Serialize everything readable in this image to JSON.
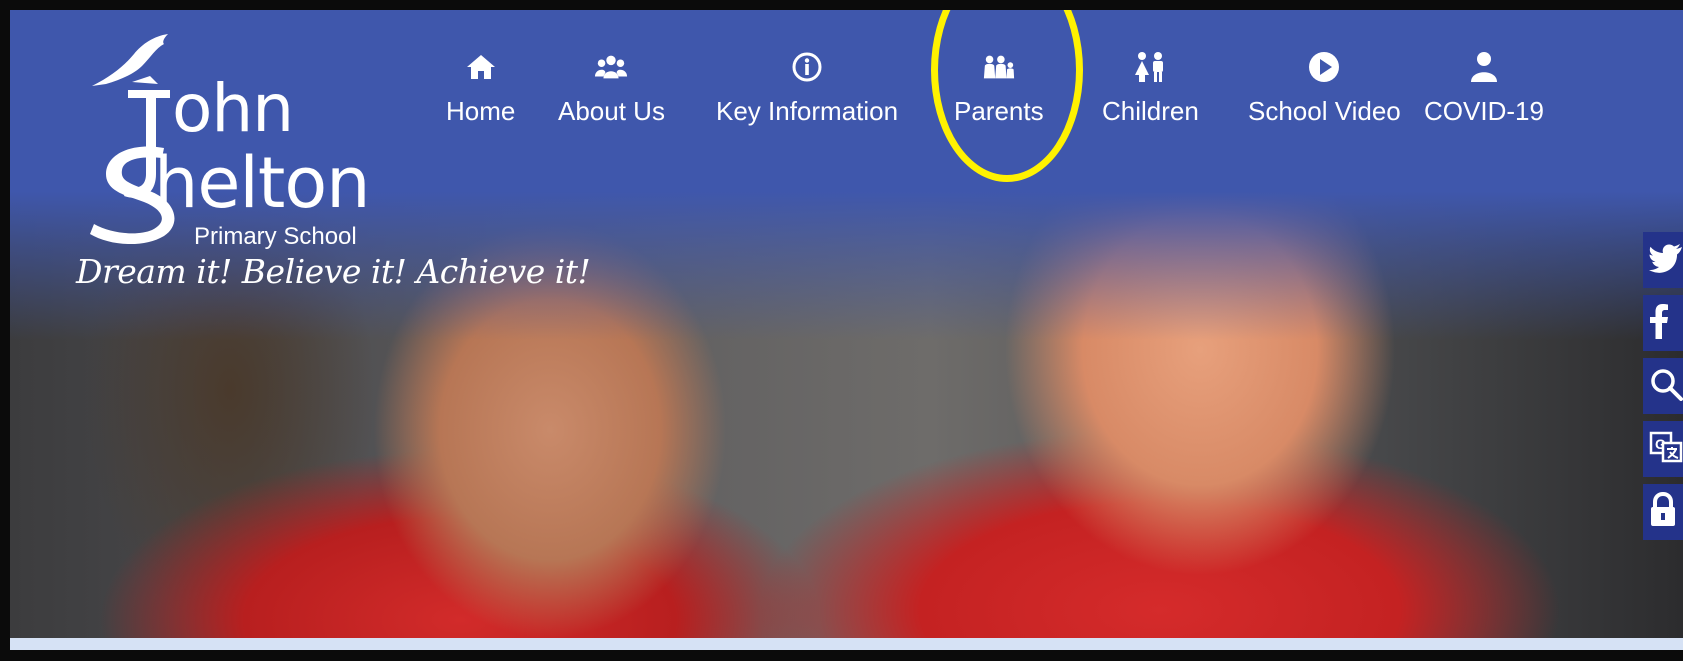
{
  "logo": {
    "line1": "ohn",
    "line2": "helton",
    "subtitle": "Primary School"
  },
  "tagline": "Dream it! Believe it! Achieve it!",
  "nav": {
    "items": [
      {
        "label": "Home",
        "icon": "home-icon"
      },
      {
        "label": "About Us",
        "icon": "people-icon"
      },
      {
        "label": "Key Information",
        "icon": "info-icon"
      },
      {
        "label": "Parents",
        "icon": "family-icon"
      },
      {
        "label": "Children",
        "icon": "children-icon"
      },
      {
        "label": "School Video",
        "icon": "play-icon"
      },
      {
        "label": "COVID-19",
        "icon": "user-icon"
      }
    ]
  },
  "side_links": [
    "twitter-icon",
    "facebook-icon",
    "search-icon",
    "translate-icon",
    "lock-icon"
  ],
  "colors": {
    "header_blue": "#3f57ac",
    "side_bar": "#24338a",
    "highlight": "#fff200"
  }
}
